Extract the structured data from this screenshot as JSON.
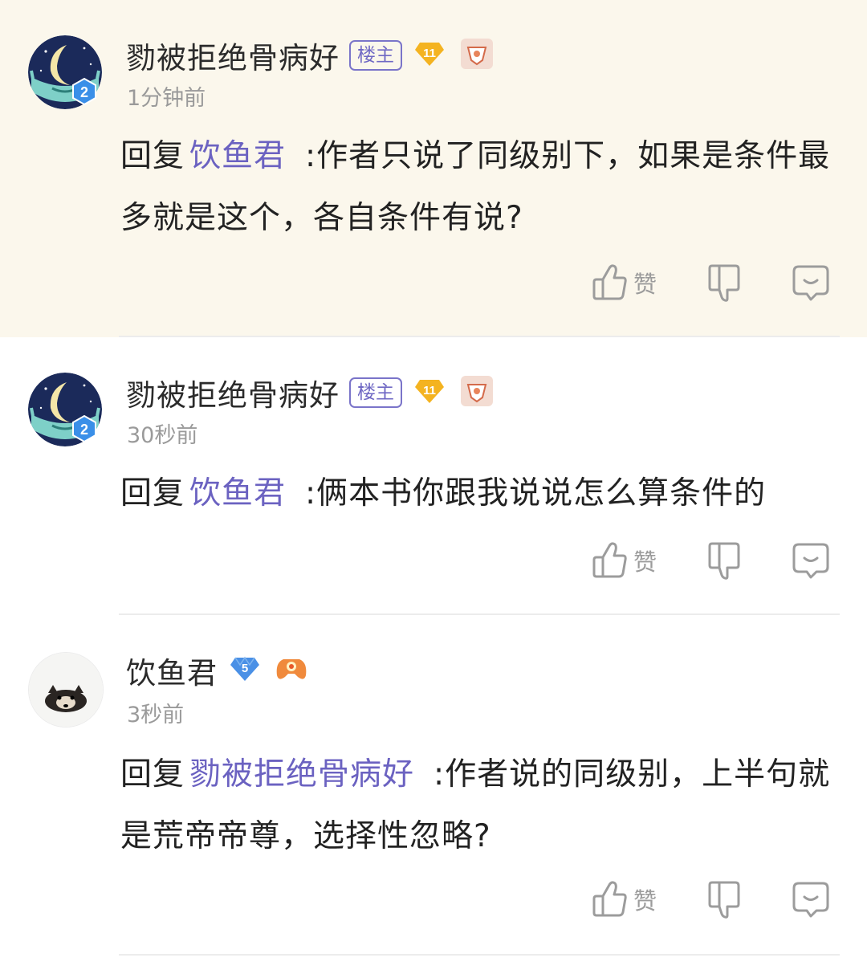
{
  "comments": [
    {
      "user": "勠被拒绝骨病好",
      "owner_tag": "楼主",
      "level": "11",
      "time": "1分钟前",
      "reply_prefix": "回复",
      "reply_to": "饮鱼君",
      "content": ":作者只说了同级别下，如果是条件最多就是这个，各自条件有说?",
      "like_label": "赞",
      "avatar_badge": "2"
    },
    {
      "user": "勠被拒绝骨病好",
      "owner_tag": "楼主",
      "level": "11",
      "time": "30秒前",
      "reply_prefix": "回复",
      "reply_to": "饮鱼君",
      "content": ":俩本书你跟我说说怎么算条件的",
      "like_label": "赞",
      "avatar_badge": "2"
    },
    {
      "user": "饮鱼君",
      "level": "5",
      "time": "3秒前",
      "reply_prefix": "回复",
      "reply_to": "勠被拒绝骨病好",
      "content": ":作者说的同级别，上半句就是荒帝帝尊，选择性忽略?",
      "like_label": "赞"
    }
  ],
  "icons": {
    "like": "thumbs-up-icon",
    "dislike": "thumbs-down-icon",
    "reply": "reply-bubble-icon"
  },
  "colors": {
    "highlight_bg": "#fbf7ec",
    "mention": "#6b62c1",
    "owner_tag": "#6f68c4",
    "level_gold": "#f4b320",
    "level_blue": "#4a90e6",
    "time": "#9a9a9a"
  }
}
